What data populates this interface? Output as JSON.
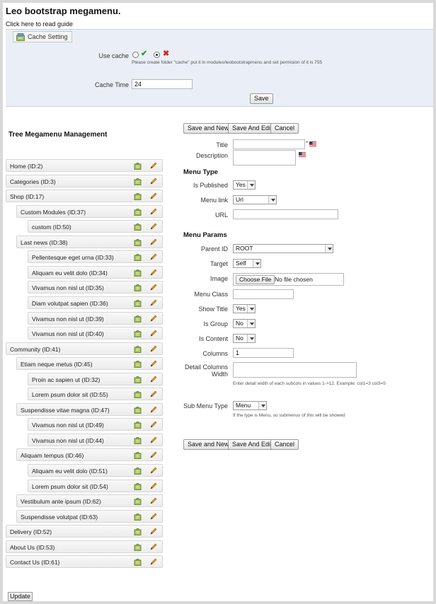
{
  "page": {
    "title": "Leo bootstrap megamenu.",
    "guide_link": "Click here to read guide"
  },
  "cache_setting": {
    "legend": "Cache Setting",
    "use_cache_label": "Use cache",
    "use_cache_value": "no",
    "note": "Please create folder \"cache\" put it in modules/leobootstrapmenu and set permision of it is 755",
    "cache_time_label": "Cache Time",
    "cache_time_value": "24",
    "save_label": "Save"
  },
  "tree": {
    "title": "Tree Megamenu Management",
    "items": [
      {
        "label": "Home (ID:2)",
        "level": 0
      },
      {
        "label": "Categories (ID:3)",
        "level": 0
      },
      {
        "label": "Shop (ID:17)",
        "level": 0
      },
      {
        "label": "Custom Modules (ID:37)",
        "level": 1
      },
      {
        "label": "custom (ID:50)",
        "level": 2
      },
      {
        "label": "Last news (ID:38)",
        "level": 1
      },
      {
        "label": "Pellentesque eget urna (ID:33)",
        "level": 2
      },
      {
        "label": "Aliquam eu velit dolo (ID:34)",
        "level": 2
      },
      {
        "label": "Vivamus non nisl ut (ID:35)",
        "level": 2
      },
      {
        "label": "Diam volutpat sapien (ID:36)",
        "level": 2
      },
      {
        "label": "Vivamus non nisl ut (ID:39)",
        "level": 2
      },
      {
        "label": "Vivamus non nisl ut (ID:40)",
        "level": 2
      },
      {
        "label": "Community (ID:41)",
        "level": 0
      },
      {
        "label": "Etiam neque metus (ID:45)",
        "level": 1
      },
      {
        "label": "Proin ac sapien ut (ID:32)",
        "level": 2
      },
      {
        "label": "Lorem psum dolor sit (ID:55)",
        "level": 2
      },
      {
        "label": "Suspendisse vitae magna (ID:47)",
        "level": 1
      },
      {
        "label": "Vivamus non nisl ut (ID:49)",
        "level": 2
      },
      {
        "label": "Vivamus non nisl ut (ID:44)",
        "level": 2
      },
      {
        "label": "Aliquam tempus (ID:46)",
        "level": 1
      },
      {
        "label": "Aliquam eu velit dolo (ID:51)",
        "level": 2
      },
      {
        "label": "Lorem psum dolor sit (ID:54)",
        "level": 2
      },
      {
        "label": "Vestibulum ante ipsum (ID:62)",
        "level": 1
      },
      {
        "label": "Suspendisse volutpat (ID:63)",
        "level": 1
      },
      {
        "label": "Delivery (ID:52)",
        "level": 0
      },
      {
        "label": "About Us (ID:53)",
        "level": 0
      },
      {
        "label": "Contact Us (ID:61)",
        "level": 0
      }
    ],
    "update_label": "Update"
  },
  "form": {
    "buttons": {
      "save_new": "Save and New",
      "save_edit": "Save And Edit",
      "cancel": "Cancel"
    },
    "title_label": "Title",
    "title_required": "*",
    "description_label": "Description",
    "menu_type_heading": "Menu Type",
    "is_published_label": "Is Published",
    "is_published_value": "Yes",
    "menu_link_label": "Menu link",
    "menu_link_value": "Url",
    "url_label": "URL",
    "menu_params_heading": "Menu Params",
    "parent_id_label": "Parent ID",
    "parent_id_value": "ROOT",
    "target_label": "Target",
    "target_value": "Self",
    "image_label": "Image",
    "choose_file_label": "Choose File",
    "no_file_text": "No file chosen",
    "menu_class_label": "Menu Class",
    "show_title_label": "Show Title",
    "show_title_value": "Yes",
    "is_group_label": "Is Group",
    "is_group_value": "No",
    "is_content_label": "Is Content",
    "is_content_value": "No",
    "columns_label": "Columns",
    "columns_value": "1",
    "detail_columns_label_1": "Detail Columns",
    "detail_columns_label_2": "Width",
    "detail_hint": "Enter detail width of each subcols in values 1->12. Example: col1=3 col3=5",
    "sub_menu_type_label": "Sub Menu Type",
    "sub_menu_type_value": "Menu",
    "sub_menu_hint": "If the type is Menu, so submenus of this will be showed"
  },
  "colors": {
    "panel_bg": "#eaeef6",
    "accept": "#2a9a2a",
    "reject": "#d22a1f",
    "edit_pencil": "#d69a18",
    "delete_basket": "#6e8a2b"
  }
}
